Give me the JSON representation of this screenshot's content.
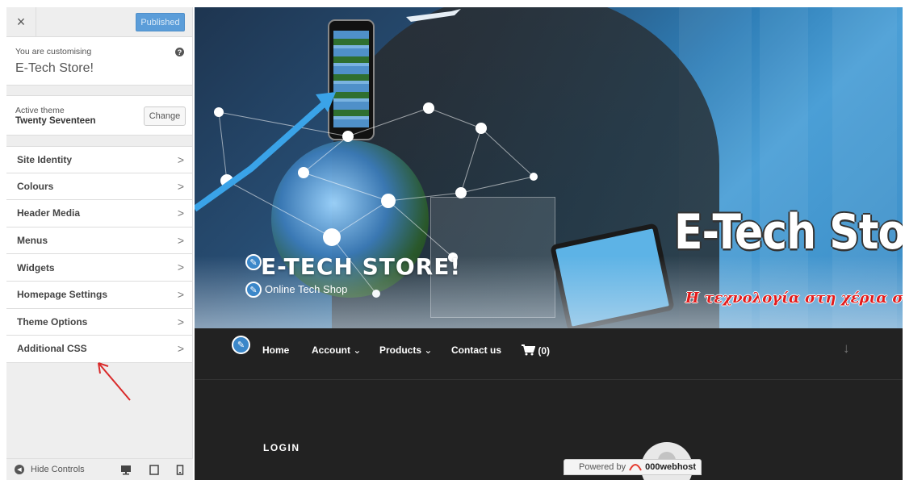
{
  "sidebar": {
    "close_label": "×",
    "publish_label": "Published",
    "customising_label": "You are customising",
    "site_name": "E-Tech Store!",
    "help_label": "?",
    "active_theme_label": "Active theme",
    "theme_name": "Twenty Seventeen",
    "change_label": "Change",
    "sections": [
      {
        "label": "Site Identity"
      },
      {
        "label": "Colours"
      },
      {
        "label": "Header Media"
      },
      {
        "label": "Menus"
      },
      {
        "label": "Widgets"
      },
      {
        "label": "Homepage Settings"
      },
      {
        "label": "Theme Options"
      },
      {
        "label": "Additional CSS"
      }
    ],
    "footer": {
      "hide_controls_label": "Hide Controls",
      "devices": [
        "desktop-icon",
        "tablet-icon",
        "mobile-icon"
      ]
    }
  },
  "preview": {
    "site_title": "E-TECH STORE!",
    "tagline": "Online Tech Shop",
    "banner_title": "E-Tech Store",
    "banner_slogan": "Η τεχνολογία στη χέρια σου!",
    "nav": {
      "home": "Home",
      "account": "Account",
      "products": "Products",
      "contact": "Contact us",
      "cart": "(0)"
    },
    "login_title": "LOGIN",
    "powered_by": "Powered by",
    "host_brand": "000webhost"
  },
  "colors": {
    "accent": "#5b9dd9",
    "arrow": "#d92a2a",
    "preview_bg": "#222222",
    "slogan": "#e21b1b"
  }
}
